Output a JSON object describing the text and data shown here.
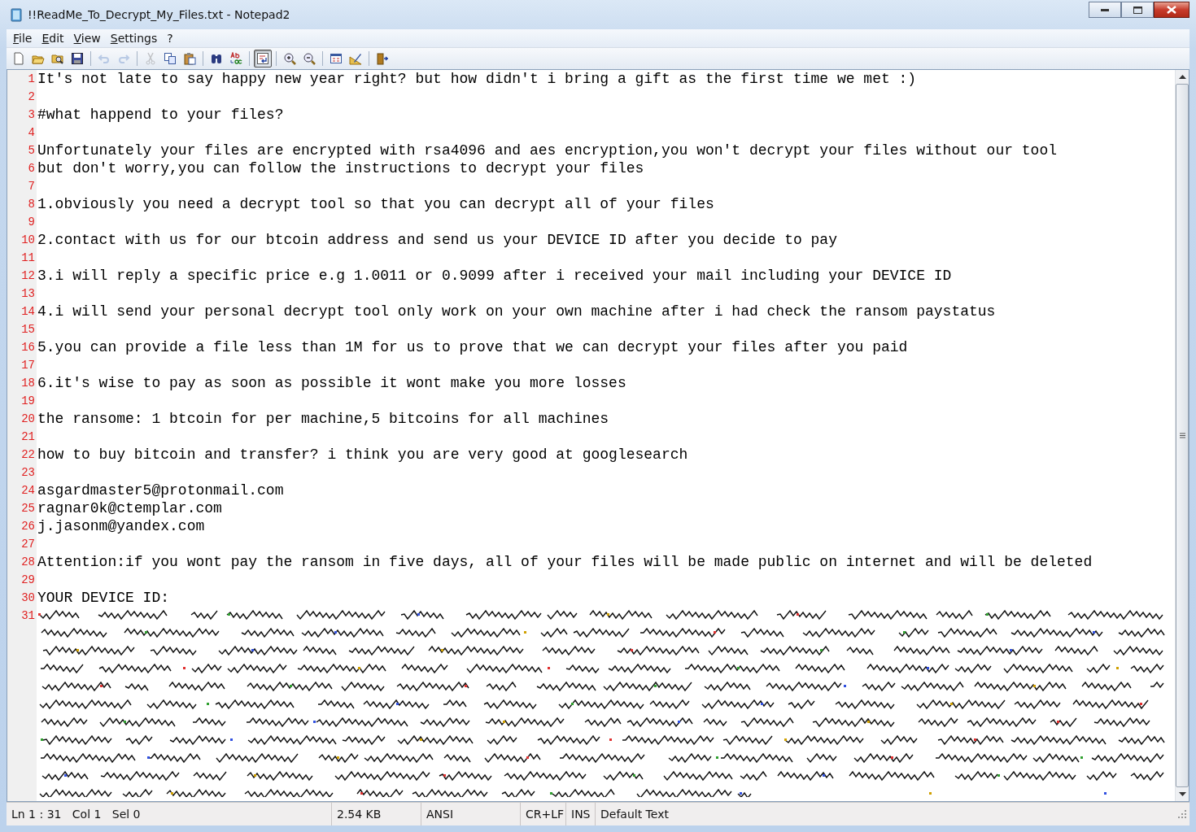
{
  "window": {
    "title": "!!ReadMe_To_Decrypt_My_Files.txt - Notepad2"
  },
  "menu": [
    {
      "label": "File"
    },
    {
      "label": "Edit"
    },
    {
      "label": "View"
    },
    {
      "label": "Settings"
    },
    {
      "label": "?"
    }
  ],
  "toolbar": [
    {
      "buttons": [
        {
          "kind": "new",
          "disabled": false,
          "selected": false
        },
        {
          "kind": "open",
          "disabled": false,
          "selected": false
        },
        {
          "kind": "browse",
          "disabled": false,
          "selected": false
        },
        {
          "kind": "save",
          "disabled": false,
          "selected": false
        }
      ]
    },
    {
      "buttons": [
        {
          "kind": "undo",
          "disabled": true,
          "selected": false
        },
        {
          "kind": "redo",
          "disabled": true,
          "selected": false
        }
      ]
    },
    {
      "buttons": [
        {
          "kind": "cut",
          "disabled": true,
          "selected": false
        },
        {
          "kind": "copy",
          "disabled": false,
          "selected": false
        },
        {
          "kind": "paste",
          "disabled": false,
          "selected": false
        }
      ]
    },
    {
      "buttons": [
        {
          "kind": "find",
          "disabled": false,
          "selected": false
        },
        {
          "kind": "replace",
          "disabled": false,
          "selected": false
        }
      ]
    },
    {
      "buttons": [
        {
          "kind": "wrap",
          "disabled": false,
          "selected": true
        }
      ]
    },
    {
      "buttons": [
        {
          "kind": "zoomin",
          "disabled": false,
          "selected": false
        },
        {
          "kind": "zoomout",
          "disabled": false,
          "selected": false
        }
      ]
    },
    {
      "buttons": [
        {
          "kind": "scheme",
          "disabled": false,
          "selected": false
        },
        {
          "kind": "customize",
          "disabled": false,
          "selected": false
        }
      ]
    },
    {
      "buttons": [
        {
          "kind": "exit",
          "disabled": false,
          "selected": false
        }
      ]
    }
  ],
  "lines": [
    {
      "number": "1",
      "text": "It's not late to say happy new year right? but how didn't i bring a gift as the first time we met :)"
    },
    {
      "number": "2"
    },
    {
      "number": "3",
      "text": "#what happend to your files?"
    },
    {
      "number": "4"
    },
    {
      "number": "5",
      "text": "Unfortunately your files are encrypted with rsa4096 and aes encryption,you won't decrypt your files without our tool"
    },
    {
      "number": "6",
      "text": "but don't worry,you can follow the instructions to decrypt your files"
    },
    {
      "number": "7"
    },
    {
      "number": "8",
      "text": "1.obviously you need a decrypt tool so that you can decrypt all of your files"
    },
    {
      "number": "9"
    },
    {
      "number": "10",
      "text": "2.contact with us for our btcoin address and send us your DEVICE ID after you decide to pay"
    },
    {
      "number": "11"
    },
    {
      "number": "12",
      "text": "3.i will reply a specific price e.g 1.0011 or 0.9099 after i received your mail including your DEVICE ID"
    },
    {
      "number": "13"
    },
    {
      "number": "14",
      "text": "4.i will send your personal decrypt tool only work on your own machine after i had check the ransom paystatus"
    },
    {
      "number": "15"
    },
    {
      "number": "16",
      "text": "5.you can provide a file less than 1M for us to prove that we can decrypt your files after you paid"
    },
    {
      "number": "17"
    },
    {
      "number": "18",
      "text": "6.it's wise to pay as soon as possible it wont make you more losses"
    },
    {
      "number": "19"
    },
    {
      "number": "20",
      "text": "the ransome: 1 btcoin for per machine,5 bitcoins for all machines"
    },
    {
      "number": "21"
    },
    {
      "number": "22",
      "text": "how to buy bitcoin and transfer? i think you are very good at googlesearch"
    },
    {
      "number": "23"
    },
    {
      "number": "24",
      "text": "asgardmaster5@protonmail.com"
    },
    {
      "number": "25",
      "text": "ragnar0k@ctemplar.com"
    },
    {
      "number": "26",
      "text": "j.jasonm@yandex.com"
    },
    {
      "number": "27"
    },
    {
      "number": "28",
      "text": "Attention:if you wont pay the ransom in five days, all of your files will be made public on internet and will be deleted"
    },
    {
      "number": "29"
    },
    {
      "number": "30",
      "text": "YOUR DEVICE ID:"
    },
    {
      "number": "31",
      "kind": "garbled"
    }
  ],
  "status_bar": [
    "Ln 1 : 31   Col 1   Sel 0",
    "2.54 KB",
    "ANSI",
    "CR+LF",
    "INS",
    "Default Text"
  ]
}
